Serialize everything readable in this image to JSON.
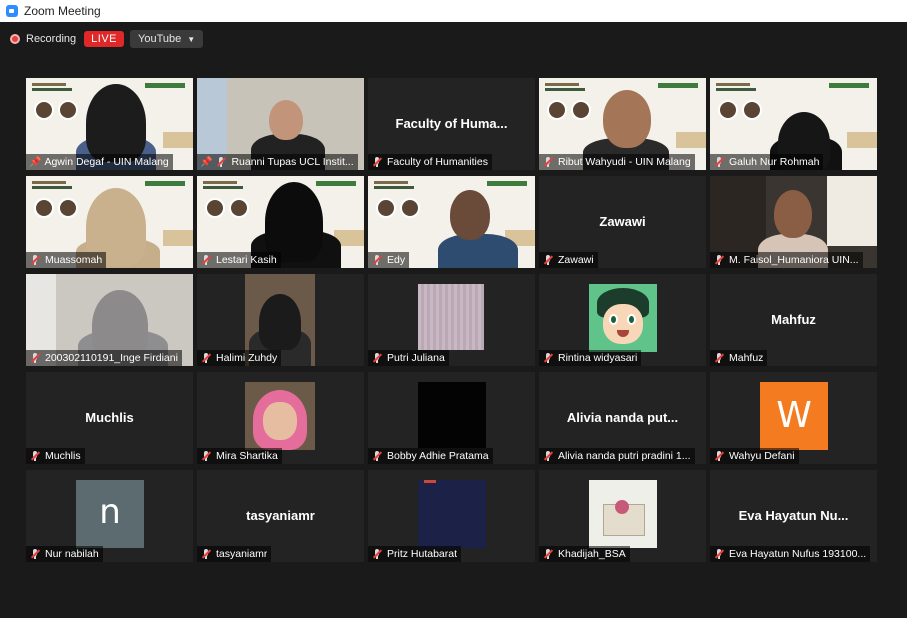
{
  "window": {
    "title": "Zoom Meeting"
  },
  "toolbar": {
    "recording_label": "Recording",
    "live_label": "LIVE",
    "stream_target": "YouTube"
  },
  "participants": [
    {
      "name": "Agwin Degaf - UIN Malang",
      "muted": false,
      "pinned": true,
      "feed": "poster-headphones",
      "active_speaker": true
    },
    {
      "name": "Ruanni Tupas UCL Instit...",
      "muted": true,
      "pinned": true,
      "feed": "room-man"
    },
    {
      "name": "Faculty of Humanities",
      "display": "Faculty of Huma...",
      "muted": true,
      "feed": "none"
    },
    {
      "name": "Ribut Wahyudi - UIN Malang",
      "muted": true,
      "feed": "poster-glasses"
    },
    {
      "name": "Galuh Nur Rohmah",
      "muted": true,
      "feed": "poster-hijab"
    },
    {
      "name": "Muassomah",
      "muted": true,
      "feed": "poster-hijab-beige"
    },
    {
      "name": "Lestari Kasih",
      "muted": true,
      "feed": "poster-niqab"
    },
    {
      "name": "Edy",
      "muted": true,
      "feed": "poster-man"
    },
    {
      "name": "Zawawi",
      "display": "Zawawi",
      "muted": true,
      "feed": "none"
    },
    {
      "name": "M. Faisol_Humaniora UIN...",
      "muted": true,
      "feed": "office-man"
    },
    {
      "name": "200302110191_Inge Firdiani",
      "muted": true,
      "feed": "hijab-grey"
    },
    {
      "name": "Halimi Zuhdy",
      "muted": true,
      "feed": "photo-bookshelf"
    },
    {
      "name": "Putri Juliana",
      "muted": true,
      "feed": "blur"
    },
    {
      "name": "Rintina widyasari",
      "muted": true,
      "feed": "cartoon"
    },
    {
      "name": "Mahfuz",
      "display": "Mahfuz",
      "muted": true,
      "feed": "none"
    },
    {
      "name": "Muchlis",
      "display": "Muchlis",
      "muted": true,
      "feed": "none"
    },
    {
      "name": "Mira Shartika",
      "muted": true,
      "feed": "photo-pink-hijab"
    },
    {
      "name": "Bobby Adhie Pratama",
      "muted": true,
      "feed": "black"
    },
    {
      "name": "Alivia nanda putri pradini 1...",
      "display": "Alivia nanda put...",
      "muted": true,
      "feed": "none"
    },
    {
      "name": "Wahyu Defani",
      "muted": true,
      "feed": "letter-w",
      "avatar_letter": "W"
    },
    {
      "name": "Nur nabilah",
      "muted": true,
      "feed": "letter-n",
      "avatar_letter": "n"
    },
    {
      "name": "tasyaniamr",
      "display": "tasyaniamr",
      "muted": true,
      "feed": "none"
    },
    {
      "name": "Pritz Hutabarat",
      "muted": true,
      "feed": "navy"
    },
    {
      "name": "Khadijah_BSA",
      "muted": true,
      "feed": "quran"
    },
    {
      "name": "Eva Hayatun Nufus 193100...",
      "display": "Eva Hayatun Nu...",
      "muted": true,
      "feed": "none"
    }
  ],
  "colors": {
    "live": "#e02828",
    "active_speaker_border": "#a6e22e",
    "muted_mic": "#e8403c",
    "background": "#1a1a1a"
  }
}
